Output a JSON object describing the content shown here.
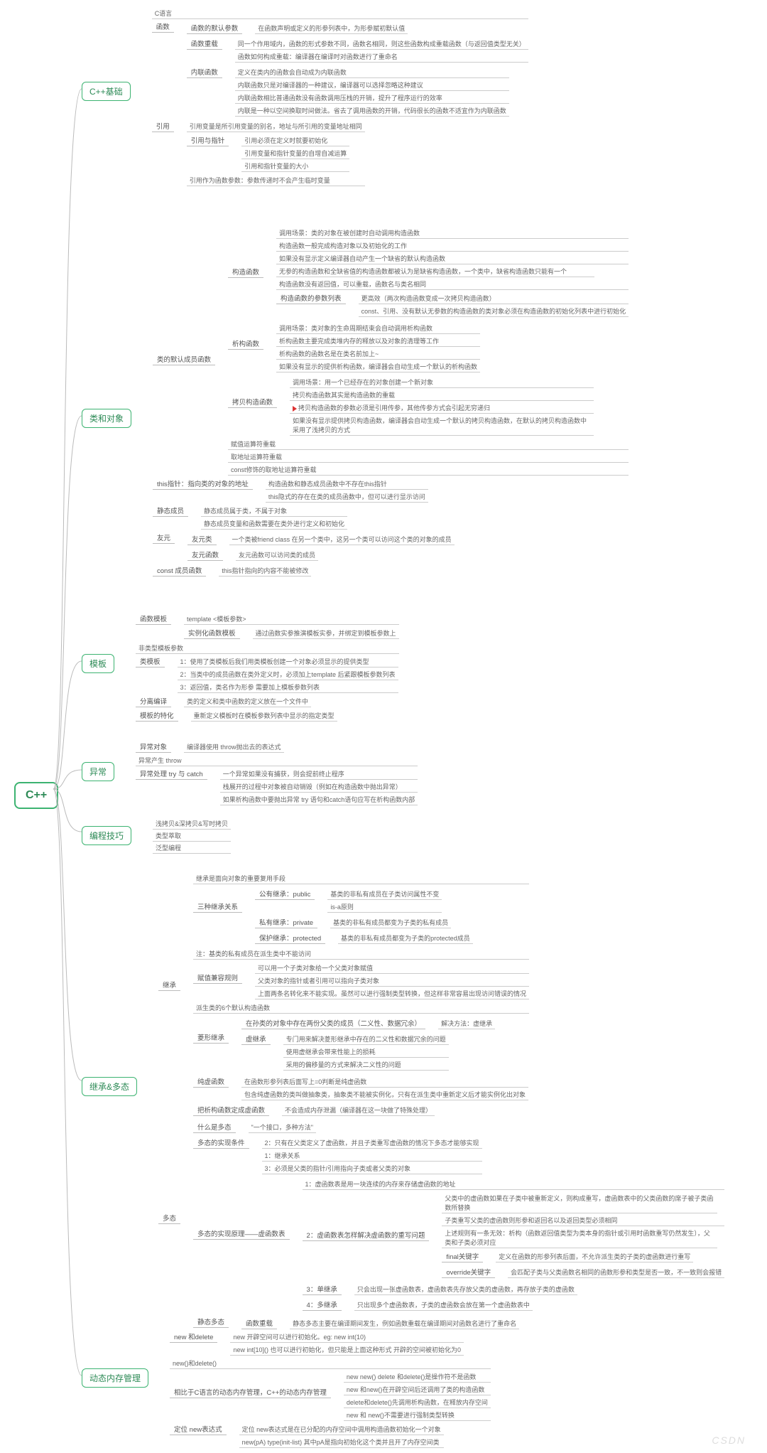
{
  "root": "C++",
  "sections": {
    "cpp_basic": "C++基础",
    "class_obj": "类和对象",
    "template": "模板",
    "exception": "异常",
    "tricks": "编程技巧",
    "inherit_poly": "继承&多态",
    "dyn_mem": "动态内存管理"
  },
  "cpp_basic": {
    "clang": "C语言",
    "func": {
      "label": "函数",
      "default_param": "函数的默认参数",
      "default_param_detail": "在函数声明或定义的形参列表中，为形参赋初默认值",
      "overload": "函数重载",
      "overload_l1": "同一个作用域内，函数的形式参数不同，函数名相同，则这些函数构成重载函数（与返回值类型无关）",
      "overload_l2": "函数如何构成重载：编译器在编译时对函数进行了重命名",
      "inline": "内联函数",
      "inline_l1": "定义在类内的函数会自动成为内联函数",
      "inline_l2": "内联函数只是对编译器的一种建议，编译器可以选择忽略这种建议",
      "inline_l3": "内联函数相比普通函数没有函数调用压栈的开销，提升了程序运行的效率",
      "inline_l4": "内联是一种以空间换取时间做法。省去了调用函数的开销，代码很长的函数不适宜作为内联函数"
    },
    "ref": {
      "label": "引用",
      "l1": "引用变量是所引用变量的别名，地址与所引用的变量地址相同",
      "sub": {
        "label": "引用与指针",
        "s1": "引用必须在定义时就要初始化",
        "s2": "引用变量和指针变量的自增自减运算",
        "s3": "引用和指针变量的大小"
      },
      "l2": "引用作为函数参数：参数传递时不会产生临时变量"
    }
  },
  "class_obj": {
    "default_members": {
      "label": "类的默认成员函数",
      "ctor": {
        "label": "构造函数",
        "l1": "调用场景：类的对象在被创建时自动调用构造函数",
        "l2": "构造函数一般完成构造对象以及初始化的工作",
        "l3": "如果没有显示定义编译器自动产生一个缺省的默认构造函数",
        "l4": "无参的构造函数和全缺省值的构造函数都被认为是缺省构造函数，一个类中，缺省构造函数只能有一个",
        "l5": "构造函数没有返回值，可以重载，函数名与类名相同",
        "paramlist": {
          "label": "构造函数的参数列表",
          "p1": "更高效（两次构造函数变成一次拷贝构造函数）",
          "p2": "const、引用、没有默认无参数的构造函数的类对象必须在构造函数的初始化列表中进行初始化"
        }
      },
      "dtor": {
        "label": "析构函数",
        "l1": "调用场景：类对象的生命周期结束会自动调用析构函数",
        "l2": "析构函数主要完成类堆内存的释放以及对象的清理等工作",
        "l3": "析构函数的函数名是在类名前加上~",
        "l4": "如果没有显示的提供析构函数，编译器会自动生成一个默认的析构函数"
      },
      "copy_ctor": {
        "label": "拷贝构造函数",
        "l1": "调用场景：用一个已经存在的对象创建一个新对象",
        "l2": "拷贝构造函数其实是构造函数的重载",
        "flag": "拷贝构造函数的参数必须是引用传参，其他传参方式会引起无穷递归",
        "l3": "如果没有显示提供拷贝构造函数，编译器会自动生成一个默认的拷贝构造函数，在默认的拷贝构造函数中采用了浅拷贝的方式"
      },
      "e1": "赋值运算符重载",
      "e2": "取地址运算符重载",
      "e3": "const修饰的取地址运算符重载"
    },
    "this_ptr": {
      "label": "this指针：指向类的对象的地址",
      "l1": "构造函数和静态成员函数中不存在this指针",
      "l2": "this隐式的存在在类的成员函数中，但可以进行显示访问"
    },
    "static_member": {
      "label": "静态成员",
      "l1": "静态成员属于类，不属于对象",
      "l2": "静态成员变量和函数需要在类外进行定义和初始化"
    },
    "friend": {
      "label": "友元",
      "friend_class": {
        "label": "友元类",
        "detail": "一个类被friend class 在另一个类中，这另一个类可以访问这个类的对象的成员"
      },
      "friend_func": {
        "label": "友元函数",
        "detail": "友元函数可以访问类的成员"
      }
    },
    "const_member": {
      "label": "const 成员函数",
      "detail": "this指针指向的内容不能被修改"
    }
  },
  "template": {
    "func_tpl": {
      "label": "函数模板",
      "l1": "template <模板参数>",
      "l2_label": "实例化函数模板",
      "l2_detail": "通过函数实参推演模板实参，并绑定到模板参数上"
    },
    "nontype": "非类型模板参数",
    "class_tpl": {
      "label": "类模板",
      "l1": "1：使用了类模板后我们用类模板创建一个对象必须显示的提供类型",
      "l2": "2：当类中的成员函数在类外定义时，必须加上template 后紧跟模板参数列表",
      "l3": "3：返回值，类名作为形参  需要加上模板参数列表"
    },
    "separate": {
      "label": "分离编译",
      "detail": "类的定义和类中函数的定义放在一个文件中"
    },
    "specialize": {
      "label": "模板的特化",
      "detail": "重新定义模板时在模板参数列表中显示的指定类型"
    }
  },
  "exception": {
    "obj": {
      "label": "异常对象",
      "detail": "编译器使用 throw抛出去的表达式"
    },
    "throw": "异常产生  throw",
    "handle": {
      "label": "异常处理  try 与 catch",
      "l1": "一个异常如果没有捕获，则会提前终止程序",
      "l2": "栈展开的过程中对象被自动销毁（例如在构造函数中抛出异常）",
      "l3": "如果析构函数中要抛出异常 try 语句和catch语句应写在析构函数内部"
    }
  },
  "tricks": {
    "l1": "浅拷贝&深拷贝&写时拷贝",
    "l2": "类型萃取",
    "l3": "泛型编程"
  },
  "inherit_poly": {
    "inherit": {
      "label": "继承",
      "l0": "继承是面向对象的重要复用手段",
      "kinds": {
        "label": "三种继承关系",
        "pub": {
          "label": "公有继承：public",
          "d1": "基类的非私有成员在子类访问属性不变",
          "d2": "is-a原则"
        },
        "priv": {
          "label": "私有继承：private",
          "d": "基类的非私有成员都变为子类的私有成员"
        },
        "prot": {
          "label": "保护继承：protected",
          "d": "基类的非私有成员都变为子类的protected成员"
        }
      },
      "note": "注：基类的私有成员在派生类中不能访问",
      "compat": {
        "label": "赋值兼容规则",
        "l1": "可以用一个子类对象给一个父类对象赋值",
        "l2": "父类对象的指针或者引用可以指向子类对象",
        "l3": "上面两条名转化来不能实现。虽然可以进行强制类型转换，但这样非常容易出现访问错误的情况"
      },
      "six": "派生类的6个默认构造函数",
      "diamond": {
        "label": "菱形继承",
        "l1": "在孙类的对象中存在两份父类的成员（二义性、数据冗余）",
        "l1tail": "解决方法：虚继承",
        "vinh": {
          "label": "虚继承",
          "v1": "专门用来解决菱形继承中存在的二义性和数据冗余的问题",
          "v2": "使用虚继承会带来性能上的损耗",
          "v3": "采用的偏移量的方式来解决二义性的问题"
        }
      },
      "pure": {
        "label": "纯虚函数",
        "l1": "在函数形参列表后面写上=0判断是纯虚函数",
        "l2": "包含纯虚函数的类叫做抽象类，抽象类不能被实例化，只有在派生类中重新定义后才能实例化出对象"
      },
      "inh_dtor": {
        "label": "把析构函数定成虚函数",
        "detail": "不会造成内存泄漏（编译器在这一块做了特殊处理）"
      }
    },
    "poly": {
      "label": "多态",
      "what": {
        "label": "什么是多态",
        "detail": "\"一个接口，多种方法\""
      },
      "cond": {
        "label": "多态的实现条件",
        "l1": "2：只有在父类定义了虚函数，并且子类重写虚函数的情况下多态才能够实现",
        "l2": "1：继承关系",
        "l3": "3：必须是父类的指针/引用指向子类或者父类的对象"
      },
      "vtable": {
        "label": "多态的实现原理——虚函数表",
        "l1": "1：虚函数表是用一块连续的内存来存储虚函数的地址",
        "rewrite": {
          "label": "2：虚函数表怎样解决虚函数的重写问题",
          "r1": "父类中的虚函数如果在子类中被重新定义，则构成重写，虚函数表中的父类函数的席子被子类函数所替换",
          "r2": "子类重写父类的虚函数则形参和返回名以及返回类型必须相同",
          "r3": "上述规则有一条无效：析构（函数返回值类型为类本身的指针或引用时函数重写仍然发生），父类和子类必须对应",
          "final_kw": {
            "label": "final关键字",
            "detail": "定义在函数的形参列表后面，不允许派生类的子类的虚函数进行重写"
          },
          "override_kw": {
            "label": "override关键字",
            "detail": "会匹配子类与父类函数名相同的函数形参和类型是否一致，不一致则会报错"
          }
        },
        "single": {
          "label": "3：单继承",
          "detail": "只会出现一张虚函数表，虚函数表先存放父类的虚函数，再存放子类的虚函数"
        },
        "multi": {
          "label": "4：多继承",
          "detail": "只出现多个虚函数表，子类的虚函数会放在第一个虚函数表中"
        }
      },
      "static_poly": {
        "label": "静态多态",
        "sub": "函数重载",
        "detail": "静态多态主要在编译期间发生，例如函数重载在编译期间对函数名进行了重命名"
      }
    }
  },
  "dyn_mem": {
    "newdel": {
      "label": "new 和delete",
      "l1": "new 开辟空间可以进行初始化。eg: new int(10)",
      "l2": "new int[10]() 也可以进行初始化，但只能是上面这种形式  开辟的空间被初始化为0"
    },
    "newdel_fn": "new()和delete()",
    "relative_c": {
      "label": "相比于C语言的动态内存管理，C++的动态内存管理",
      "l1": "new new() delete 和delete()是操作符不是函数",
      "l2": "new 和new()在开辟空间后还调用了类的构造函数",
      "l3": "delete和delete()先调用析构函数，在释放内存空间",
      "l4": "new 和 new()不需要进行强制类型转换"
    },
    "placement_new": {
      "label": "定位 new表达式",
      "l1": "定位 new表达式是在已分配的内存空间中调用构造函数初始化一个对象",
      "l2": "new(pA) type(init-list) 其中pA是指向初始化这个类并且开了内存空间类"
    }
  },
  "watermark": "CSDN"
}
